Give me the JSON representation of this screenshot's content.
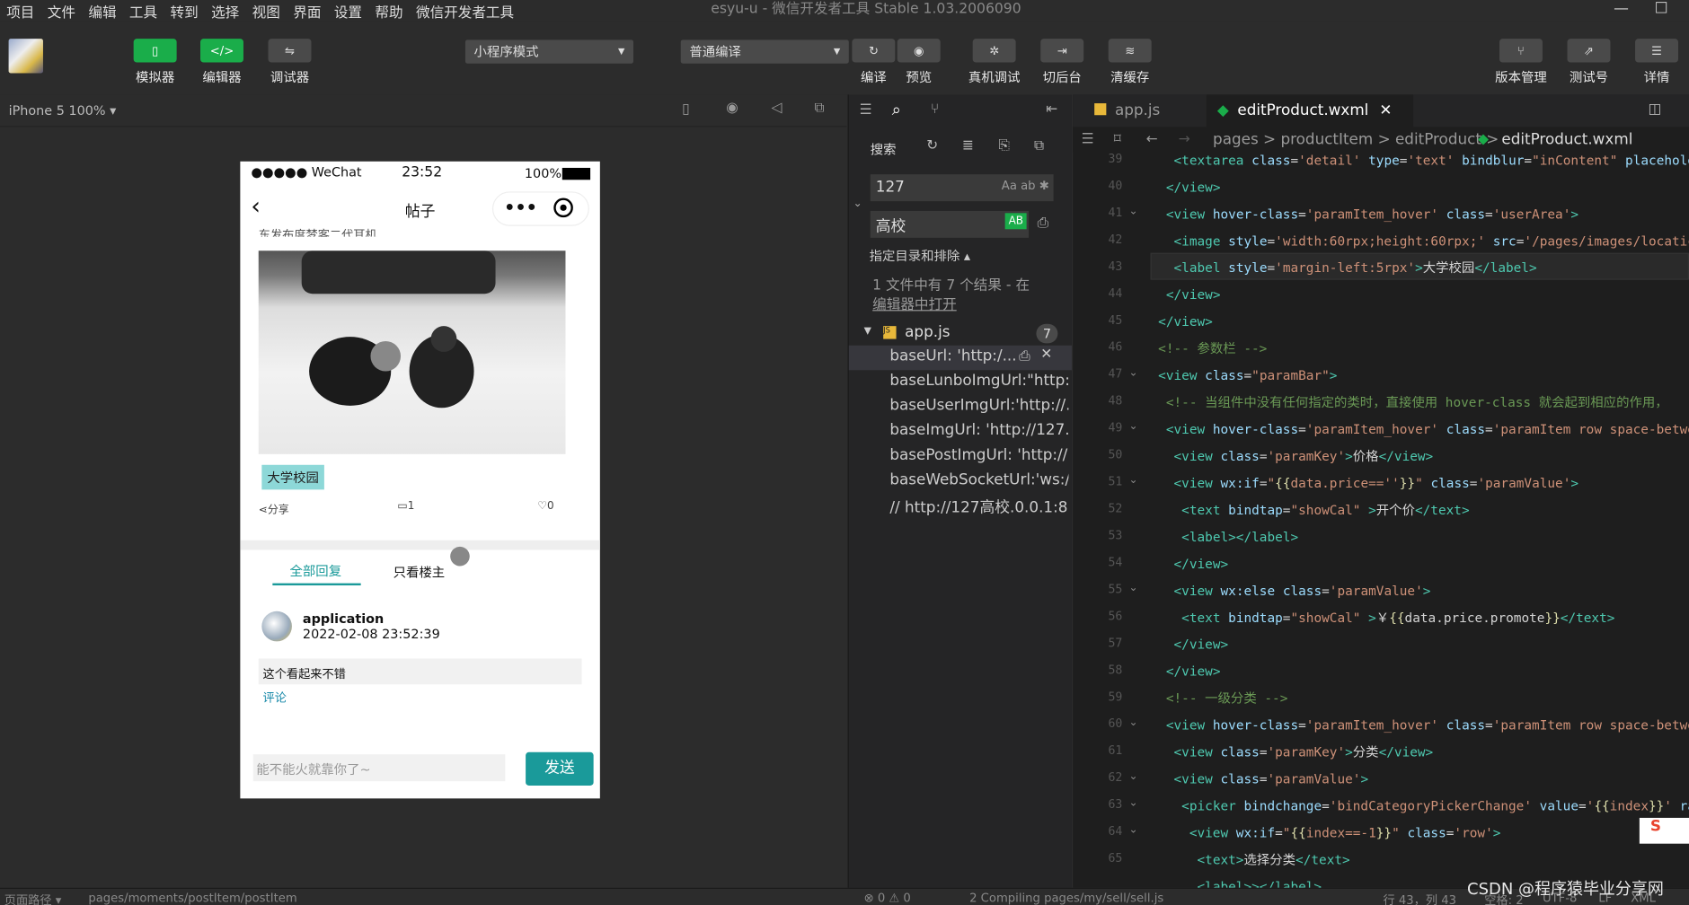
{
  "menu": [
    "项目",
    "文件",
    "编辑",
    "工具",
    "转到",
    "选择",
    "视图",
    "界面",
    "设置",
    "帮助",
    "微信开发者工具"
  ],
  "window_title": "esyu-u - 微信开发者工具 Stable 1.03.2006090",
  "toolbar": {
    "simulator": "模拟器",
    "editor": "编辑器",
    "debugger": "调试器",
    "mode_select": "小程序模式",
    "compile_select": "普通编译",
    "compile": "编译",
    "preview": "预览",
    "real_debug": "真机调试",
    "background": "切后台",
    "clear_cache": "清缓存",
    "version": "版本管理",
    "test": "测试号",
    "details": "详情"
  },
  "device": "iPhone 5 100%",
  "phone": {
    "carrier": "●●●●● WeChat",
    "time": "23:52",
    "battery": "100%",
    "title": "帖子",
    "cut_text": "东发布度梦客二代耳机",
    "tag": "大学校园",
    "share": "分享",
    "comment_count": "1",
    "like_count": "0",
    "tab_all": "全部回复",
    "tab_owner": "只看楼主",
    "user": "application",
    "datetime": "2022-02-08 23:52:39",
    "reply": "这个看起来不错",
    "comment_link": "评论",
    "input_placeholder": "能不能火就靠你了~",
    "send": "发送"
  },
  "search": {
    "title": "搜索",
    "query": "127",
    "replace": "高校",
    "options": "指定目录和排除",
    "summary1": "1 文件中有 7 个结果 - 在",
    "summary2": "编辑器中打开",
    "file": "app.js",
    "count": "7",
    "results": [
      "baseUrl: 'http:/...",
      "baseLunboImgUrl:\"http:...",
      "baseUserImgUrl:'http://...",
      "baseImgUrl: 'http://127...",
      "basePostImgUrl: 'http://...",
      "baseWebSocketUrl:'ws:/...",
      "// http://127高校.0.0.1:8..."
    ]
  },
  "editor": {
    "tab1": "app.js",
    "tab2": "editProduct.wxml",
    "crumbs": "pages > productItem > editProduct >",
    "crumb_file": "editProduct.wxml",
    "lines": [
      "39",
      "40",
      "41",
      "42",
      "43",
      "44",
      "45",
      "46",
      "47",
      "48",
      "49",
      "50",
      "51",
      "52",
      "53",
      "54",
      "55",
      "56",
      "57",
      "58",
      "59",
      "60",
      "61",
      "62",
      "63",
      "64",
      "65"
    ]
  },
  "status": {
    "path_label": "页面路径",
    "path": "pages/moments/postItem/postItem",
    "errors": "⊗ 0 ⚠ 0",
    "compiling": "2 Compiling pages/my/sell/sell.js",
    "pos": "行 43，列 43",
    "spaces": "空格: 2",
    "enc": "UTF-8",
    "eol": "LF",
    "lang": "XML"
  },
  "watermark": "CSDN @程序猿毕业分享网",
  "colors": {
    "accent": "#1aad4a",
    "teal": "#1a9a9a"
  }
}
